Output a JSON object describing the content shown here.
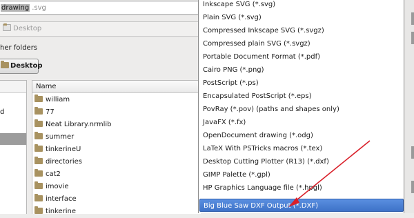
{
  "save_dialog": {
    "name_selected": "drawing",
    "name_extension": ".svg",
    "location": "Desktop",
    "browse_label": "her folders",
    "pathbar_button": "Desktop",
    "places_visible_item": "d",
    "column_name": "Name",
    "files": [
      "william",
      "77",
      "Neat Library.nrmlib",
      "summer",
      "tinkerineU",
      "directories",
      "cat2",
      "imovie",
      "interface",
      "tinkerine"
    ]
  },
  "filetype_menu": {
    "items": [
      "Inkscape SVG (*.svg)",
      "Plain SVG (*.svg)",
      "Compressed Inkscape SVG (*.svgz)",
      "Compressed plain SVG (*.svgz)",
      "Portable Document Format (*.pdf)",
      "Cairo PNG (*.png)",
      "PostScript (*.ps)",
      "Encapsulated PostScript (*.eps)",
      "PovRay (*.pov) (paths and shapes only)",
      "JavaFX (*.fx)",
      "OpenDocument drawing (*.odg)",
      "LaTeX With PSTricks macros (*.tex)",
      "Desktop Cutting Plotter (R13) (*.dxf)",
      "GIMP Palette (*.gpl)",
      "HP Graphics Language file (*.hpgl)",
      "Big Blue Saw DXF Output (*.DXF)"
    ],
    "highlighted_index": 15
  },
  "colors": {
    "highlight": "#3e72c8",
    "annotation_arrow": "#d9202a"
  }
}
